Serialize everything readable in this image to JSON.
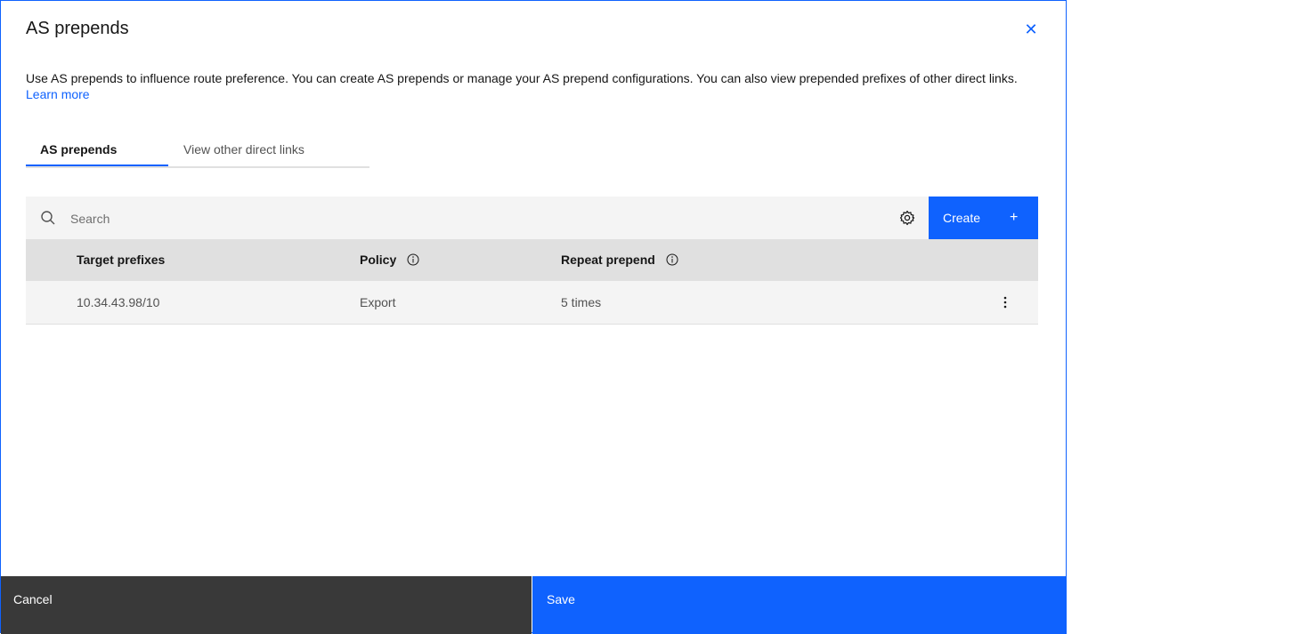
{
  "modal": {
    "title": "AS prepends",
    "description": "Use AS prepends to influence route preference. You can create AS prepends or manage your AS prepend configurations. You can also view prepended prefixes of other direct links.",
    "learn_more": "Learn more"
  },
  "tabs": [
    {
      "label": "AS prepends",
      "active": true
    },
    {
      "label": "View other direct links",
      "active": false
    }
  ],
  "toolbar": {
    "search_placeholder": "Search",
    "create_label": "Create",
    "create_icon": "add-icon",
    "settings_icon": "gear-icon"
  },
  "table": {
    "headers": [
      "Target prefixes",
      "Policy",
      "Repeat prepend"
    ],
    "rows": [
      {
        "target_prefix": "10.34.43.98/10",
        "policy": "Export",
        "repeat_prepend": "5 times"
      }
    ]
  },
  "footer": {
    "cancel_label": "Cancel",
    "save_label": "Save"
  },
  "colors": {
    "accent": "#0f62fe",
    "secondary_button": "#393939",
    "table_header": "#e0e0e0",
    "table_row": "#f4f4f4"
  }
}
